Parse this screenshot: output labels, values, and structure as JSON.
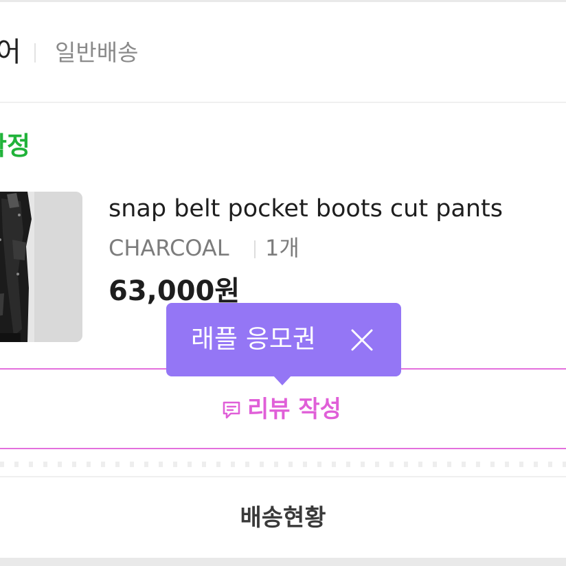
{
  "header": {
    "store_name": "어",
    "shipping_type": "일반배송"
  },
  "order": {
    "status": "확정"
  },
  "product": {
    "name": "snap belt pocket boots cut pants",
    "color": "CHARCOAL",
    "quantity": "1개",
    "price": "63,000원",
    "thumbnail_icon": "product-photo"
  },
  "tooltip": {
    "text": "래플 응모권",
    "close_icon": "close-icon"
  },
  "review_button": {
    "label": "리뷰 작성",
    "icon": "review-comment-icon"
  },
  "delivery": {
    "label": "배송현황"
  },
  "colors": {
    "status_green": "#21b33a",
    "review_pink": "#e05fd8",
    "review_border": "#e36fdd",
    "tooltip_purple": "#9476f5"
  }
}
